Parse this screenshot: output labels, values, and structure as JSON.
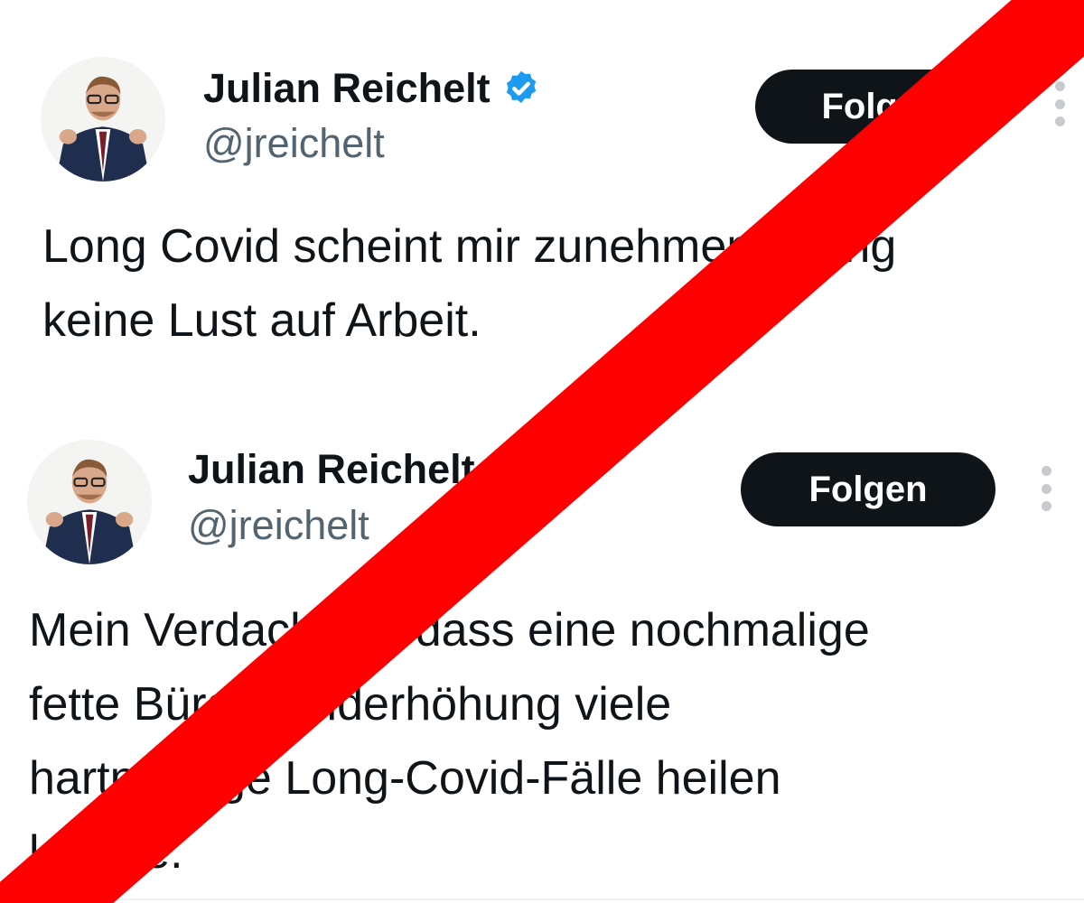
{
  "tweets": [
    {
      "author": {
        "display_name": "Julian Reichelt",
        "handle": "@jreichelt",
        "verified_icon": "verified-badge-icon"
      },
      "follow_label": "Folgen",
      "more_icon": "more-options-icon",
      "text": "Long Covid scheint mir zunehmend Long\nkeine Lust auf Arbeit."
    },
    {
      "author": {
        "display_name": "Julian Reichelt",
        "handle": "@jreichelt",
        "verified_icon": "verified-badge-icon"
      },
      "follow_label": "Folgen",
      "more_icon": "more-options-icon",
      "text": "Mein Verdacht ist, dass eine nochmalige\nfette Bürgergelderhöhung viele\nhartnäckige Long-Covid-Fälle heilen\nkönnte."
    }
  ],
  "colors": {
    "verified_blue": "#1d9bf0",
    "button_bg": "#0f1419",
    "handle_gray": "#536471",
    "strike_red": "#ff0000"
  }
}
